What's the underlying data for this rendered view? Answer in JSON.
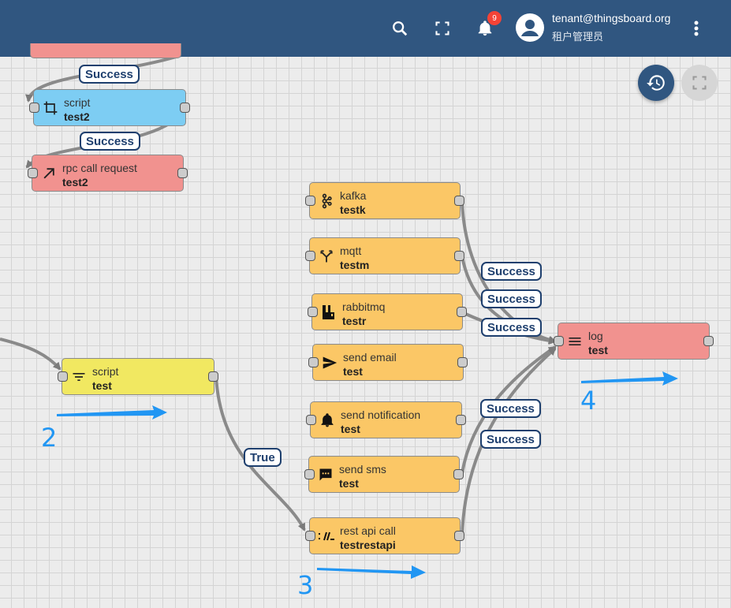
{
  "header": {
    "user_email": "tenant@thingsboard.org",
    "user_role": "租户管理员",
    "notification_count": "9"
  },
  "nodes": {
    "script_test2": {
      "type": "script",
      "name": "test2",
      "icon": "crop-icon"
    },
    "rpc_test2": {
      "type": "rpc call request",
      "name": "test2",
      "icon": "arrow-up-right-icon"
    },
    "script_test": {
      "type": "script",
      "name": "test",
      "icon": "filter-icon"
    },
    "kafka": {
      "type": "kafka",
      "name": "testk",
      "icon": "kafka-icon"
    },
    "mqtt": {
      "type": "mqtt",
      "name": "testm",
      "icon": "call-split-icon"
    },
    "rabbitmq": {
      "type": "rabbitmq",
      "name": "testr",
      "icon": "rabbitmq-icon"
    },
    "send_email": {
      "type": "send email",
      "name": "test",
      "icon": "send-icon"
    },
    "send_notification": {
      "type": "send notification",
      "name": "test",
      "icon": "bell-icon"
    },
    "send_sms": {
      "type": "send sms",
      "name": "test",
      "icon": "sms-icon"
    },
    "rest_api": {
      "type": "rest api call",
      "name": "testrestapi",
      "icon": "rest-api-icon"
    },
    "log": {
      "type": "log",
      "name": "test",
      "icon": "menu-lines-icon"
    }
  },
  "links": {
    "success": "Success",
    "true": "True"
  },
  "annotations": {
    "step2": "2",
    "step3": "3",
    "step4": "4"
  },
  "colors": {
    "header": "#305680",
    "action_node": "#fbc766",
    "external_node_red": "#f1928f",
    "transform_node": "#7dcdf3",
    "filter_node": "#f1e861",
    "link_label": "#1e3f6e",
    "annotation_arrow": "#2196f3"
  }
}
